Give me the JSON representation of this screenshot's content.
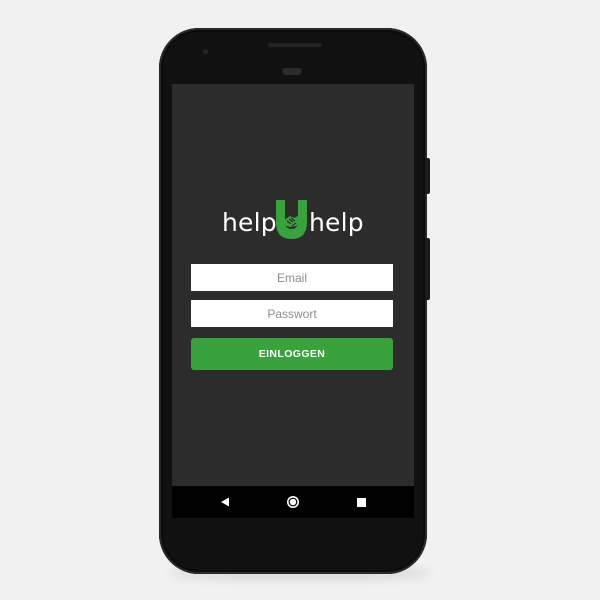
{
  "app": {
    "logo": {
      "word_left": "help",
      "word_right": "help",
      "mark_icon": "handshake-u-icon",
      "mark_color": "#3aa23d"
    }
  },
  "login_form": {
    "email": {
      "placeholder": "Email",
      "value": ""
    },
    "password": {
      "placeholder": "Passwort",
      "value": ""
    },
    "submit_label": "EINLOGGEN"
  },
  "navigation_bar": {
    "back_icon": "back-triangle-icon",
    "home_icon": "home-circle-icon",
    "recent_icon": "recent-apps-square-icon"
  },
  "colors": {
    "accent": "#3aa23d",
    "screen_background": "#2c2c2c",
    "device_body": "#111111",
    "navigation_bar": "#000000",
    "page_background": "#f1f1f1"
  }
}
